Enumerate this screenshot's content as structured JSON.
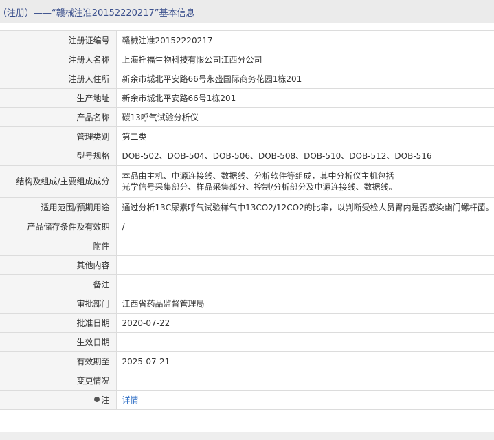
{
  "header": {
    "prefix": "（注册）——“",
    "reg_no": "赣械注准20152220217",
    "suffix": "”基本信息"
  },
  "rows": [
    {
      "label": "注册证编号",
      "value": "赣械注准20152220217"
    },
    {
      "label": "注册人名称",
      "value": "上海托福生物科技有限公司江西分公司"
    },
    {
      "label": "注册人住所",
      "value": "新余市城北平安路66号永盛国际商务花园1栋201"
    },
    {
      "label": "生产地址",
      "value": "新余市城北平安路66号1栋201"
    },
    {
      "label": "产品名称",
      "value": "碳13呼气试验分析仪"
    },
    {
      "label": "管理类别",
      "value": "第二类"
    },
    {
      "label": "型号规格",
      "value": "DOB-502、DOB-504、DOB-506、DOB-508、DOB-510、DOB-512、DOB-516"
    },
    {
      "label": "结构及组成/主要组成成分",
      "value_line1": "本品由主机、电源连接线、数据线、分析软件等组成，其中分析仪主机包括",
      "value_line2": "光学信号采集部分、样品采集部分、控制/分析部分及电源连接线、数据线。"
    },
    {
      "label": "适用范围/预期用途",
      "value": "通过分析13C尿素呼气试验样气中13CO2/12CO2的比率，以判断受检人员胃内是否感染幽门螺杆菌。"
    },
    {
      "label": "产品储存条件及有效期",
      "value": "/"
    },
    {
      "label": "附件",
      "value": ""
    },
    {
      "label": "其他内容",
      "value": ""
    },
    {
      "label": "备注",
      "value": ""
    },
    {
      "label": "审批部门",
      "value": "江西省药品监督管理局"
    },
    {
      "label": "批准日期",
      "value": "2020-07-22"
    },
    {
      "label": "生效日期",
      "value": ""
    },
    {
      "label": "有效期至",
      "value": "2025-07-21"
    },
    {
      "label": "变更情况",
      "value": ""
    },
    {
      "label": "注",
      "value": "详情"
    }
  ]
}
